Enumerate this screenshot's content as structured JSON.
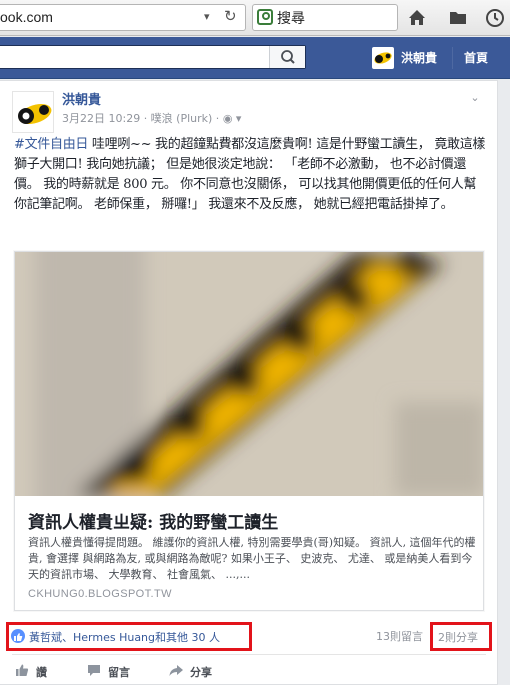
{
  "browser": {
    "url": "ook.com",
    "search_placeholder": "搜尋"
  },
  "fb_header": {
    "username": "洪朝貴",
    "home_label": "首頁"
  },
  "post": {
    "author": "洪朝貴",
    "meta": "3月22日 10:29 · 噗浪 (Plurk) · ",
    "hashtag": "#文件自由日",
    "text": " 哇哩咧~~ 我的超鐘點費都沒這麼貴啊! 這是什野蠻工讀生， 竟敢這樣獅子大開口! 我向她抗議； 但是她很淡定地說： 「老師不必激動， 也不必討價還價。 我的時薪就是 800 元。 你不同意也沒關係， 可以找其他開價更低的任何人幫你記筆記啊。 老師保重， 掰囉!」 我還來不及反應， 她就已經把電話掛掉了。",
    "link": {
      "title": "資訊人權貴ㄓ疑: 我的野蠻工讀生",
      "description": "資訊人權貴懂得提問題。 維護你的資訊人權, 特別需要學貴(哥)知疑。 資訊人, 這個年代的權貴, 會選擇 與網路為友, 或與網路為敵呢? 如果小王子、 史波克、 尤達、 或是納美人看到今天的資訊市場、 大學教育、 社會風氣、 ...,...",
      "domain": "CKHUNG0.BLOGSPOT.TW"
    },
    "likes": "黃哲斌、Hermes Huang和其他 30 人",
    "comments_count": "13則留言",
    "shares_count": "2則分享",
    "actions": {
      "like": "讚",
      "comment": "留言",
      "share": "分享"
    }
  },
  "colors": {
    "fb_blue": "#3b5998",
    "link_blue": "#365899",
    "highlight_red": "#e2131a"
  }
}
